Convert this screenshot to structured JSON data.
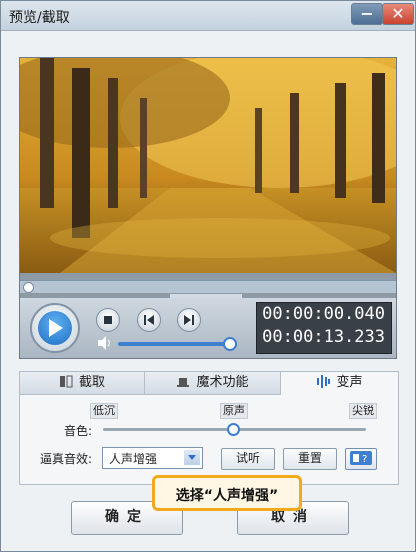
{
  "window": {
    "title": "预览/截取",
    "min_glyph": "−",
    "close_glyph": "✕"
  },
  "player": {
    "current_time": "00:00:00.040",
    "total_time": "00:00:13.233",
    "progress_fraction": 0.0,
    "volume_fraction": 1.0
  },
  "tabs": [
    {
      "label": "截取",
      "icon": "crop-icon"
    },
    {
      "label": "魔术功能",
      "icon": "magic-hat-icon"
    },
    {
      "label": "变声",
      "icon": "voice-wave-icon"
    }
  ],
  "voice": {
    "pitch_label": "音色:",
    "low": "低沉",
    "mid": "原声",
    "high": "尖锐",
    "pitch_fraction": 0.5,
    "effect_label": "逼真音效:",
    "effect_value": "人声增强",
    "preview_button": "试听",
    "reset_button": "重置",
    "help_icon": "help-icon"
  },
  "tip": {
    "text": "选择“人声增强”"
  },
  "footer": {
    "ok": "确定",
    "cancel": "取消"
  },
  "colors": {
    "accent": "#3f7fd0",
    "tip_border": "#f2a91a",
    "close": "#c9412f"
  }
}
